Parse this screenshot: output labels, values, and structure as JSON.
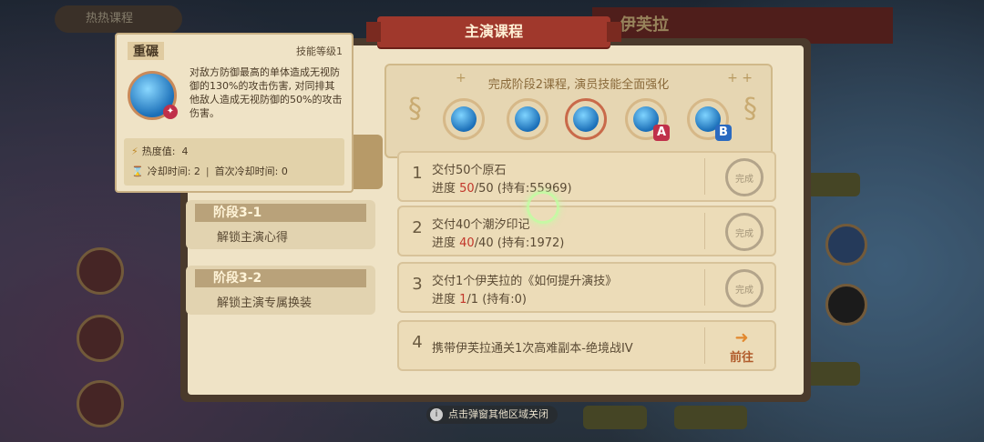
{
  "background": {
    "tab_label": "热热课程",
    "hero_name": "伊芙拉"
  },
  "panel": {
    "title": "主演课程",
    "header_text": "完成阶段2课程, 演员技能全面强化",
    "skill_icons": [
      {
        "icon": "spirit-swirl-icon",
        "tag": ""
      },
      {
        "icon": "water-wave-icon",
        "tag": ""
      },
      {
        "icon": "shield-break-icon",
        "tag": ""
      },
      {
        "icon": "water-wave-icon",
        "tag": "A"
      },
      {
        "icon": "water-wave-icon",
        "tag": "B"
      }
    ],
    "tasks": [
      {
        "num": "1",
        "line1": "交付50个原石",
        "progress_label": "进度 ",
        "cur": "50",
        "rest": "/50 (持有:55969)",
        "status": "完成"
      },
      {
        "num": "2",
        "line1": "交付40个潮汐印记",
        "progress_label": "进度 ",
        "cur": "40",
        "rest": "/40 (持有:1972)",
        "status": "完成"
      },
      {
        "num": "3",
        "line1": "交付1个伊芙拉的《如何提升演技》",
        "progress_label": "进度 ",
        "cur": "1",
        "rest": "/1 (持有:0)",
        "status": "完成"
      },
      {
        "num": "4",
        "single": "携带伊芙拉通关1次高难副本-绝境战IV",
        "go": "前往"
      }
    ],
    "phases": [
      {
        "title": "阶段3-1",
        "desc": "解锁主演心得"
      },
      {
        "title": "阶段3-2",
        "desc": "解锁主演专属换装"
      }
    ]
  },
  "hint": "点击弹窗其他区域关闭",
  "tooltip": {
    "name": "重碾",
    "level_label": "技能等级1",
    "description": "对敌方防御最高的单体造成无视防御的130%的攻击伤害, 对同排其他敌人造成无视防御的50%的攻击伤害。",
    "heat_label": "热度值:",
    "heat_value": "4",
    "cooldown_label": "冷却时间:",
    "cooldown_value": "2",
    "first_cd_label": "首次冷却时间:",
    "first_cd_value": "0"
  }
}
